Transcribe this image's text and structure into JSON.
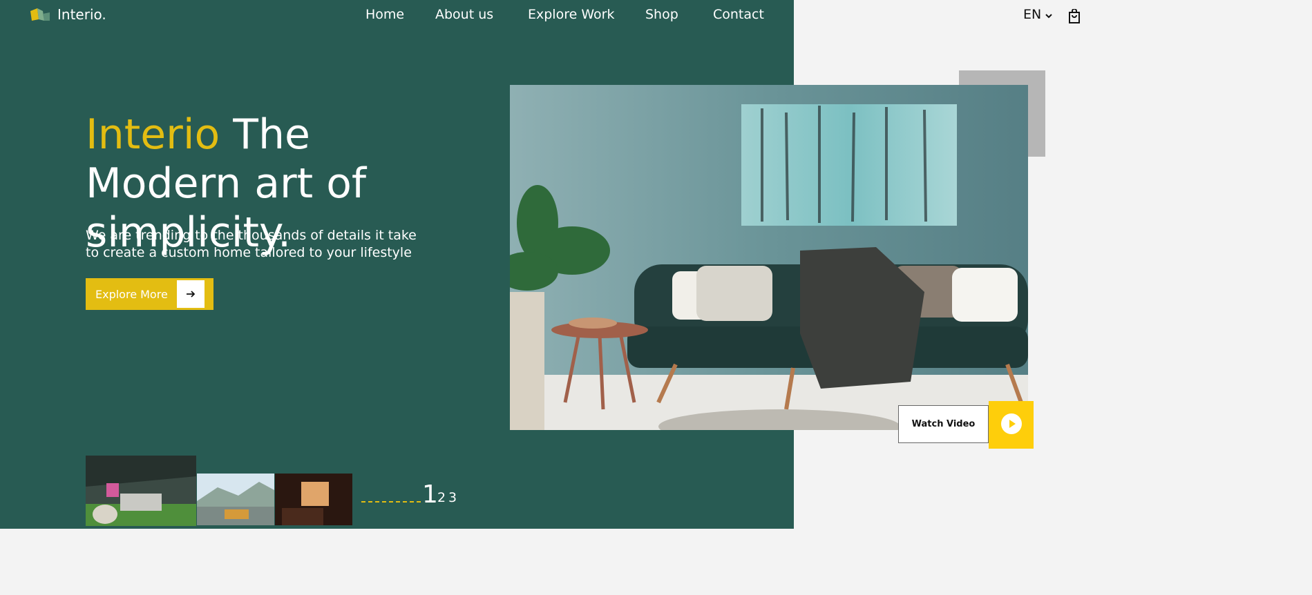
{
  "brand": {
    "name": "Interio."
  },
  "nav": {
    "items": [
      {
        "label": "Home"
      },
      {
        "label": "About us"
      },
      {
        "label": "Explore Work"
      },
      {
        "label": "Shop"
      },
      {
        "label": "Contact"
      }
    ]
  },
  "header": {
    "language": "EN",
    "cart_icon": "shopping-bag-icon"
  },
  "hero": {
    "title_accent": "Interio",
    "title_rest": "The Modern art of simplicity.",
    "subtitle": "We are trending to the thousands of details it take to create a custom home tailored to your lifestyle",
    "cta_label": "Explore More",
    "watch_video_label": "Watch Video"
  },
  "slider": {
    "pages": [
      "1",
      "2",
      "3"
    ],
    "current": "1"
  },
  "colors": {
    "primary_green": "#285b53",
    "accent_yellow": "#e3bd12",
    "play_yellow": "#fece0b",
    "background": "#f3f3f3"
  }
}
